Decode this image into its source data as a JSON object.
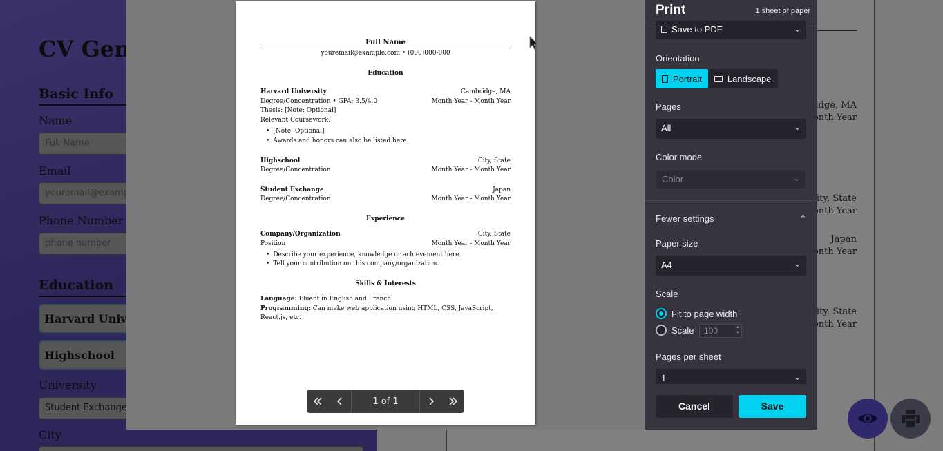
{
  "app": {
    "title": "CV Gene",
    "sections": {
      "basic_info": "Basic Info",
      "education": "Education"
    },
    "fields": {
      "name_label": "Name",
      "name_placeholder": "Full Name",
      "email_label": "Email",
      "email_placeholder": "youremail@exampl",
      "phone_label": "Phone Number",
      "phone_placeholder": "phone number",
      "university_label": "University",
      "university_value": "Student Exchange",
      "city_label": "City"
    },
    "education_cards": [
      "Harvard Unive",
      "Highschool"
    ],
    "right_preview": {
      "loc1": "ridge, MA",
      "date1": "onth Year",
      "loc2": "City, State",
      "date2": "onth Year",
      "loc3": "Japan",
      "date3": "onth Year",
      "loc4": "City, State",
      "date4": "onth Year"
    }
  },
  "print_dialog": {
    "title": "Print",
    "sheets": "1 sheet of paper",
    "destination": "Save to PDF",
    "orientation_label": "Orientation",
    "portrait": "Portrait",
    "landscape": "Landscape",
    "pages_label": "Pages",
    "pages_value": "All",
    "color_label": "Color mode",
    "color_value": "Color",
    "fewer_settings": "Fewer settings",
    "paper_size_label": "Paper size",
    "paper_size_value": "A4",
    "scale_label": "Scale",
    "fit_width": "Fit to page width",
    "scale_option": "Scale",
    "scale_value": "100",
    "pages_per_sheet_label": "Pages per sheet",
    "pages_per_sheet_value": "1",
    "cancel": "Cancel",
    "save": "Save",
    "page_counter": "1 of 1"
  },
  "cv": {
    "name": "Full Name",
    "contact": "youremail@example.com • (000)000-000",
    "education_heading": "Education",
    "edu": [
      {
        "school": "Harvard University",
        "location": "Cambridge, MA",
        "degree": "Degree/Concentration • GPA: 3.5/4.0",
        "dates": "Month Year - Month Year"
      },
      {
        "school": "Highschool",
        "location": "City, State",
        "degree": "Degree/Concentration",
        "dates": "Month Year - Month Year"
      },
      {
        "school": "Student Exchange",
        "location": "Japan",
        "degree": "Degree/Concentration",
        "dates": "Month Year - Month Year"
      }
    ],
    "thesis": "Thesis: [Note: Optional]",
    "coursework": "Relevant Coursework:",
    "edu_bullets": [
      "[Note: Optional]",
      "Awards and honors can also be listed here."
    ],
    "experience_heading": "Experience",
    "job": {
      "company": "Company/Organization",
      "location": "City, State",
      "position": "Position",
      "dates": "Month Year - Month Year"
    },
    "job_bullets": [
      "Describe your experience, knowledge or achievement here.",
      "Tell your contribution on this company/organization."
    ],
    "skills_heading": "Skills & Interests",
    "language_label": "Language:",
    "language_value": "Fluent in English and French",
    "programming_label": "Programming:",
    "programming_value": "Can make web application using HTML, CSS, JavaScript,",
    "programming_value_2": "React.js, etc."
  },
  "icons": {
    "first_page": "double-chevron-left",
    "prev_page": "chevron-left",
    "next_page": "chevron-right",
    "last_page": "double-chevron-right",
    "preview": "eye-icon",
    "print": "printer-icon"
  },
  "colors": {
    "accent": "#00d2f0",
    "panel_bg": "#37343f",
    "preview_fab": "#2f2a6e"
  }
}
